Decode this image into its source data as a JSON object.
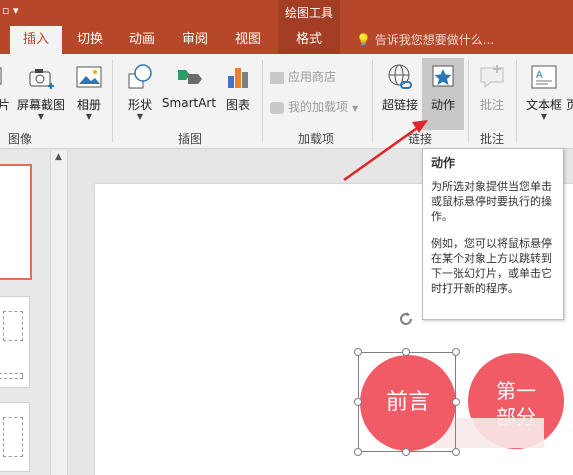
{
  "titlebar": {
    "quick_access": "▫ ▾",
    "contextual_group": "绘图工具"
  },
  "tabs": {
    "insert": "插入",
    "transitions": "切换",
    "animations": "动画",
    "review": "审阅",
    "view": "视图",
    "format": "格式",
    "tell_me": "告诉我您想要做什么..."
  },
  "ribbon": {
    "picture_partial": "片",
    "screenshot": "屏幕截图",
    "album": "相册",
    "shapes": "形状",
    "smartart": "SmartArt",
    "chart": "图表",
    "store": "应用商店",
    "my_addins": "我的加载项",
    "hyperlink": "超链接",
    "action": "动作",
    "comment": "批注",
    "textbox": "文本框",
    "textbox_partial": "页",
    "groups": {
      "images": "图像",
      "illustrations": "插图",
      "addins": "加载项",
      "links": "链接",
      "comments": "批注"
    }
  },
  "tooltip": {
    "title": "动作",
    "para1": "为所选对象提供当您单击或鼠标悬停时要执行的操作。",
    "para2": "例如，您可以将鼠标悬停在某个对象上方以跳转到下一张幻灯片，或单击它时打开新的程序。"
  },
  "slide": {
    "circle1": "前言",
    "circle2_line1": "第一",
    "circle2_line2": "部分"
  },
  "colors": {
    "accent": "#b7472a",
    "circle": "#f15b66",
    "arrow": "#e0252a"
  }
}
